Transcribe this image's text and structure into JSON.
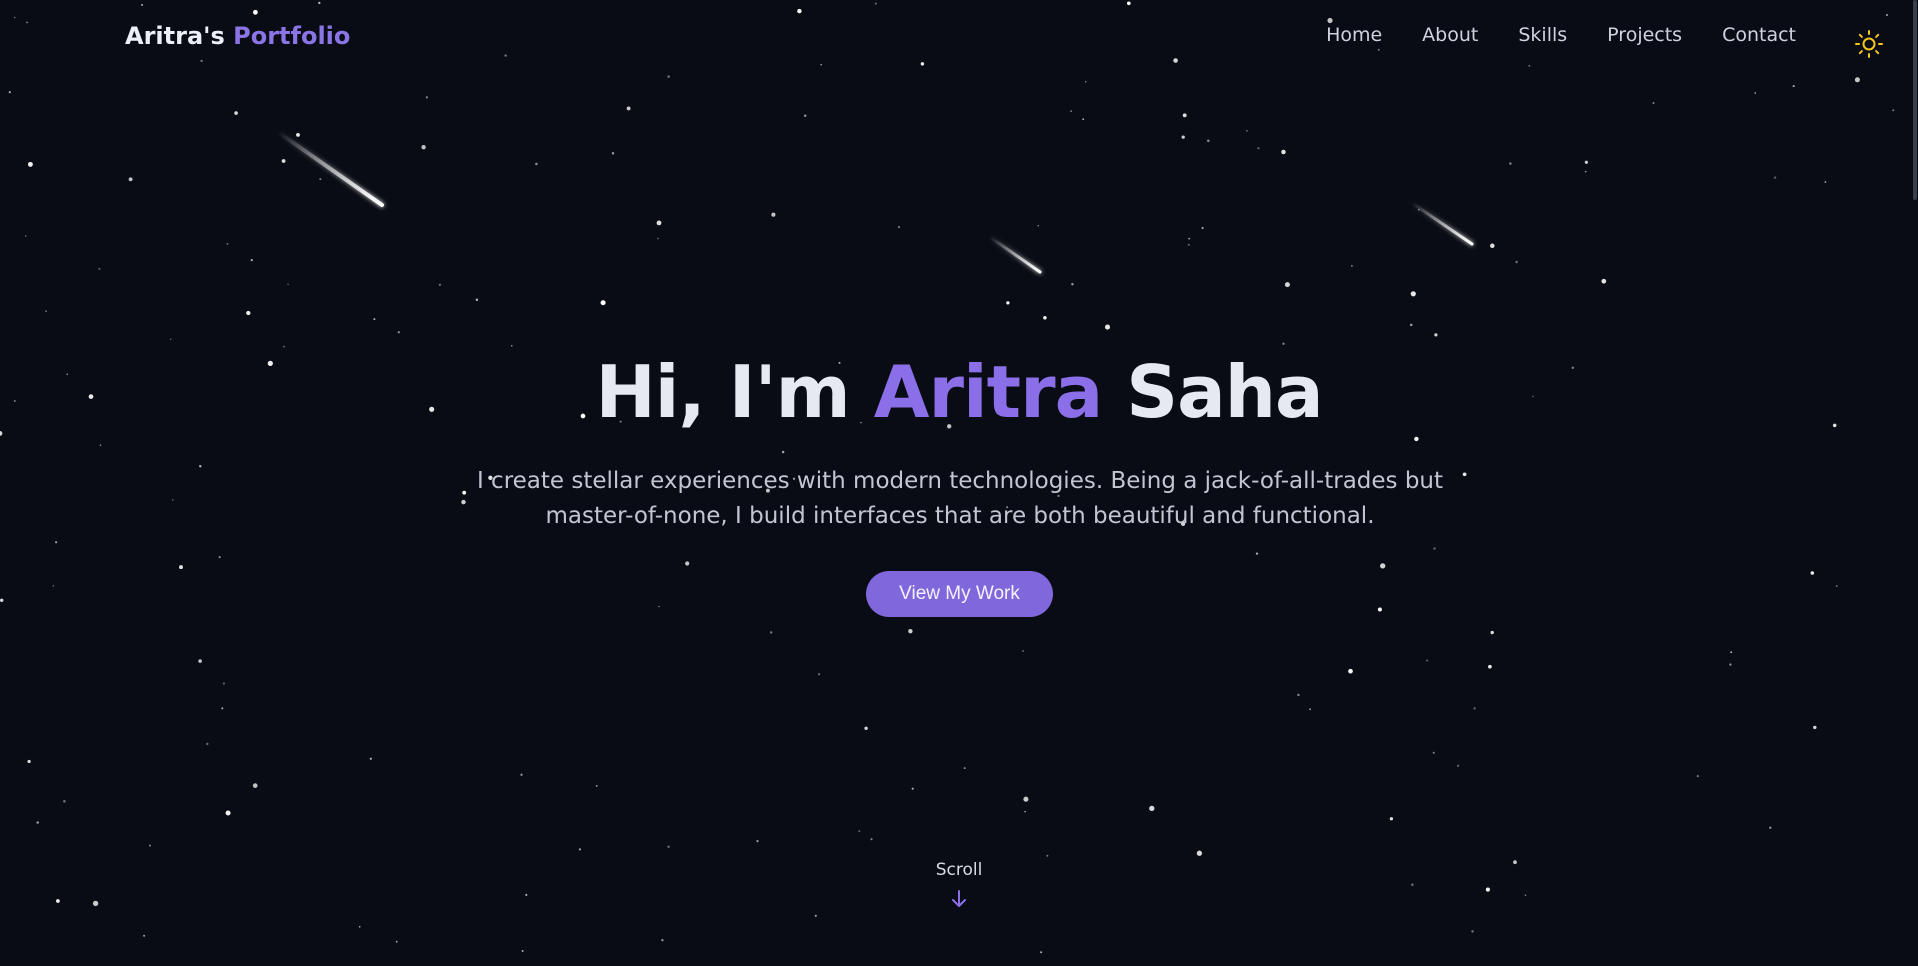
{
  "header": {
    "logo_prefix": "Aritra's",
    "logo_accent": "Portfolio",
    "nav": [
      {
        "label": "Home"
      },
      {
        "label": "About"
      },
      {
        "label": "Skills"
      },
      {
        "label": "Projects"
      },
      {
        "label": "Contact"
      }
    ],
    "theme_toggle_icon": "sun-icon"
  },
  "hero": {
    "greeting": "Hi, I'm",
    "first_name": "Aritra",
    "last_name": "Saha",
    "description": "I create stellar experiences with modern technologies. Being a jack-of-all-trades but master-of-none, I build interfaces that are both beautiful and functional.",
    "cta_label": "View My Work",
    "scroll_label": "Scroll",
    "scroll_icon": "arrow-down-icon"
  },
  "colors": {
    "background": "#090c14",
    "accent": "#8b6fe8",
    "button": "#8068dc",
    "sun": "#f5c518",
    "text": "#e6e9f2"
  }
}
